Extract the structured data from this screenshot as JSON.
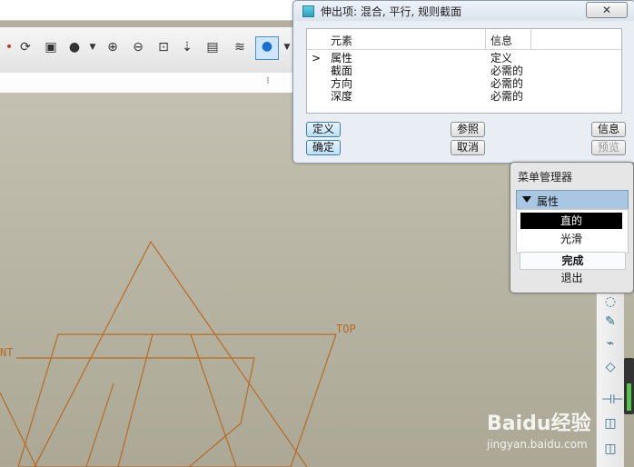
{
  "toolbar": {
    "icons": [
      "sketch-tool-icon",
      "regenerate-icon",
      "view-manager-icon",
      "shading-icon",
      "dropdown-icon",
      "zoom-in-icon",
      "zoom-out-icon",
      "refit-icon",
      "datum-display-icon",
      "annotation-display-icon",
      "layers-icon",
      "display-style-icon",
      "dropdown-icon"
    ]
  },
  "canvas": {
    "label_top": "TOP",
    "label_front": "NT"
  },
  "dialog": {
    "title": "伸出项: 混合, 平行, 规则截面",
    "close_symbol": "✕",
    "headers": {
      "element": "元素",
      "info": "信息"
    },
    "rows": [
      {
        "marker": ">",
        "element": "属性",
        "info": "定义"
      },
      {
        "marker": "",
        "element": "截面",
        "info": "必需的"
      },
      {
        "marker": "",
        "element": "方向",
        "info": "必需的"
      },
      {
        "marker": "",
        "element": "深度",
        "info": "必需的"
      }
    ],
    "buttons": {
      "define": "定义",
      "reference": "参照",
      "info": "信息",
      "ok": "确定",
      "cancel": "取消",
      "preview": "预览"
    }
  },
  "menu_manager": {
    "title": "菜单管理器",
    "section": "属性",
    "options": [
      "直的",
      "光滑"
    ],
    "selected": "直的",
    "done": "完成",
    "exit": "退出"
  },
  "watermark": {
    "brand": "Baidu经验",
    "url": "jingyan.baidu.com"
  }
}
